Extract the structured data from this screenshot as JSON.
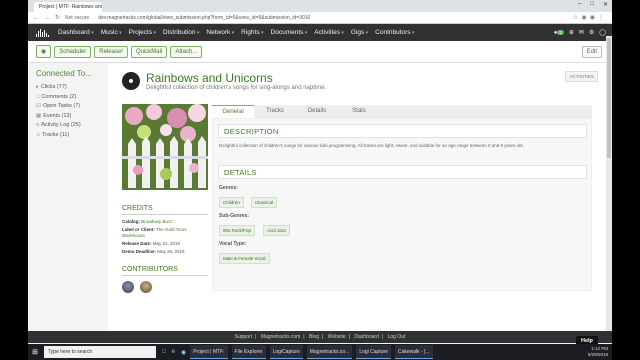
{
  "browser": {
    "tab_title": "Project | MTF: Rainbows and Uni",
    "address_secure": "Not secure",
    "url": "dev.magnetracks.com/global/view_submission.php?form_id=5&view_id=5&submission_id=3010"
  },
  "nav": {
    "items": [
      "Dashboard",
      "Music",
      "Projects",
      "Distribution",
      "Network",
      "Rights",
      "Documents",
      "Activities",
      "Gigs",
      "Contributors"
    ],
    "notif_count": "2"
  },
  "toolbar": {
    "scheduler": "Scheduler",
    "release": "Release!",
    "quickmail": "QuickMail",
    "attach": "Attach...",
    "edit": "Edit"
  },
  "sidebar": {
    "title": "Connected To...",
    "items": [
      "Clicks (77)",
      "Comments (2)",
      "Open Tasks (7)",
      "Events (13)",
      "Activity Log (25)",
      "Tracks (11)"
    ]
  },
  "project": {
    "title": "Rainbows and Unicorns",
    "subtitle": "Delightful collection of children's songs for sing-alongs and naptime.",
    "activities_btn": "ACTIVITIES"
  },
  "tabs": [
    "General",
    "Tracks",
    "Details",
    "Stats"
  ],
  "description": {
    "heading": "DESCRIPTION",
    "text": "Delightful collection of children's songs for various kids programming. All tracks are light, sweet, and suitable for an age range between 0 and 9 years old."
  },
  "details": {
    "heading": "DETAILS",
    "genres_label": "Genres:",
    "genres": [
      "Children",
      "Classical"
    ],
    "subgenres_label": "Sub-Genres:",
    "subgenres": [
      "80s Rock/Pop",
      "Acid Jazz"
    ],
    "vocal_label": "Vocal Type:",
    "vocal": [
      "Male & Female Vocal"
    ]
  },
  "credits": {
    "heading": "CREDITS",
    "catalog_label": "Catalog:",
    "catalog": "Broadway Buzz",
    "label_label": "Label or Client:",
    "label": "The Gold Tours Warehouse",
    "release_label": "Release Date:",
    "release": "May 21, 2019",
    "demo_label": "Demo Deadline:",
    "demo": "May 26, 2019"
  },
  "contributors": {
    "heading": "CONTRIBUTORS"
  },
  "footer": {
    "links": [
      "Support",
      "Magnetracks.com",
      "Blog",
      "Website",
      "Dashboard",
      "Log Out"
    ]
  },
  "help": "Help",
  "taskbar": {
    "search": "Type here to search",
    "apps": [
      "Project | MTF:",
      "File Explorer",
      "LogiCapture",
      "Magnetracks.co...",
      "Logi Capture",
      "Cakewalk - [..."
    ],
    "time": "1:12 PM",
    "date": "5/29/2019"
  }
}
